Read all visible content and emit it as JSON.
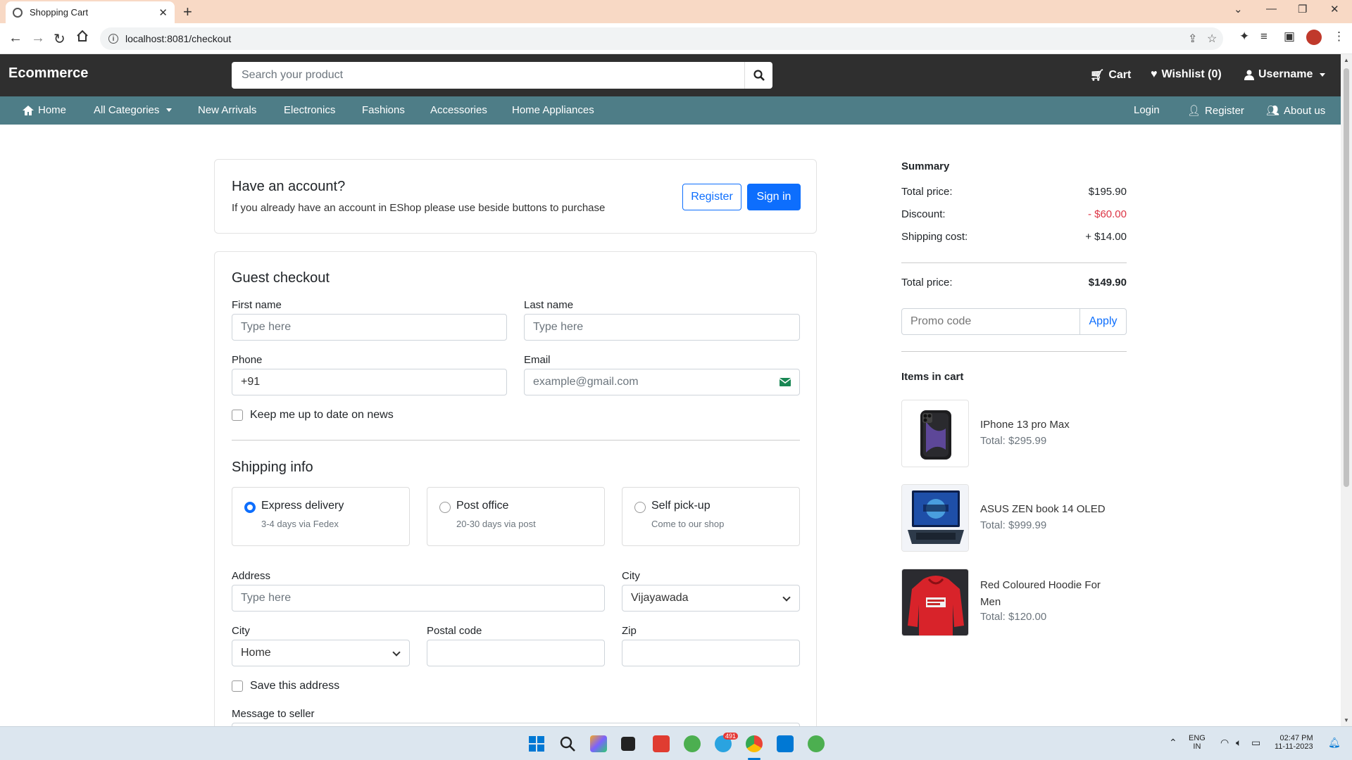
{
  "browser": {
    "tab_title": "Shopping Cart",
    "url": "localhost:8081/checkout"
  },
  "header": {
    "brand": "Ecommerce",
    "search_placeholder": "Search your product",
    "cart": "Cart",
    "wishlist": "Wishlist (0)",
    "username": "Username"
  },
  "catnav": {
    "items": [
      "Home",
      "All Categories",
      "New Arrivals",
      "Electronics",
      "Fashions",
      "Accessories",
      "Home Appliances"
    ],
    "right": [
      "Login",
      "Register",
      "About us"
    ]
  },
  "account": {
    "title": "Have an account?",
    "text": "If you already have an account in EShop please use beside buttons to purchase",
    "register": "Register",
    "signin": "Sign in"
  },
  "guest": {
    "title": "Guest checkout",
    "first_name_label": "First name",
    "first_name_placeholder": "Type here",
    "last_name_label": "Last name",
    "last_name_placeholder": "Type here",
    "phone_label": "Phone",
    "phone_value": "+91",
    "email_label": "Email",
    "email_placeholder": "example@gmail.com",
    "news_label": "Keep me up to date on news"
  },
  "shipping": {
    "title": "Shipping info",
    "options": [
      {
        "title": "Express delivery",
        "sub": "3-4 days via Fedex",
        "selected": true
      },
      {
        "title": "Post office",
        "sub": "20-30 days via post",
        "selected": false
      },
      {
        "title": "Self pick-up",
        "sub": "Come to our shop",
        "selected": false
      }
    ],
    "address_label": "Address",
    "address_placeholder": "Type here",
    "city_label": "City",
    "city_value": "Vijayawada",
    "city2_label": "City",
    "city2_value": "Home",
    "postal_label": "Postal code",
    "zip_label": "Zip",
    "save_label": "Save this address",
    "message_label": "Message to seller"
  },
  "summary": {
    "title": "Summary",
    "total_label": "Total price:",
    "total_value": "$195.90",
    "discount_label": "Discount:",
    "discount_value": "- $60.00",
    "shipping_label": "Shipping cost:",
    "shipping_value": "+ $14.00",
    "final_label": "Total price:",
    "final_value": "$149.90",
    "promo_placeholder": "Promo code",
    "apply": "Apply",
    "items_title": "Items in cart",
    "items": [
      {
        "name": "IPhone 13 pro Max",
        "total": "Total: $295.99"
      },
      {
        "name": "ASUS ZEN book 14 OLED",
        "total": "Total: $999.99"
      },
      {
        "name": "Red Coloured Hoodie For Men",
        "total": "Total: $120.00"
      }
    ]
  },
  "taskbar": {
    "lang": "ENG",
    "region": "IN",
    "time": "02:47 PM",
    "date": "11-11-2023",
    "badge": "491"
  },
  "colors": {
    "topnav": "#2f2f2f",
    "catnav": "#4e7d87",
    "primary": "#0d6efd",
    "discount": "#dc3545"
  }
}
